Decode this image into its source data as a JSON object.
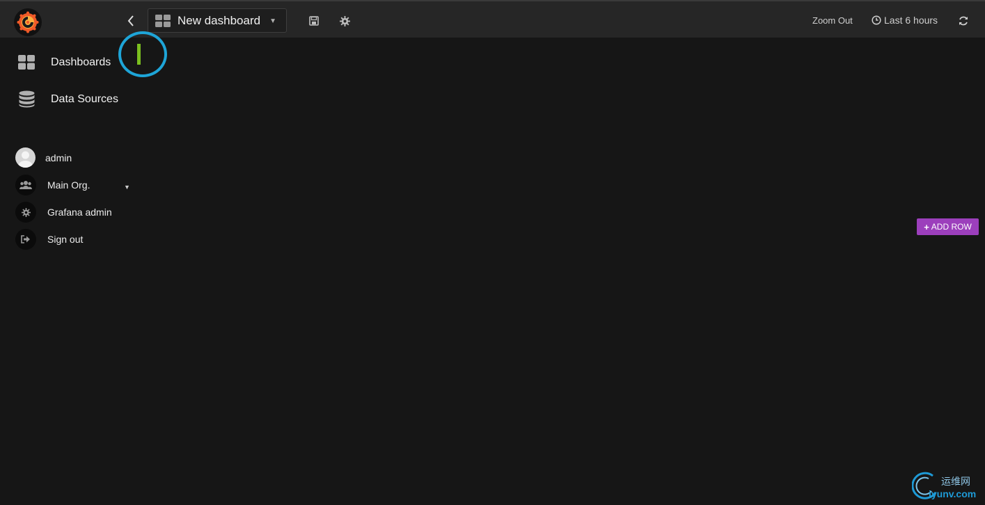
{
  "topbar": {
    "dashboard_title": "New dashboard",
    "zoom_out_label": "Zoom Out",
    "time_range_label": "Last 6 hours"
  },
  "sidemenu": {
    "items": [
      {
        "label": "Dashboards",
        "icon": "dashboards-grid-icon"
      },
      {
        "label": "Data Sources",
        "icon": "database-icon"
      }
    ],
    "user": {
      "name": "admin",
      "org": "Main Org.",
      "grafana_admin": "Grafana admin",
      "sign_out": "Sign out"
    }
  },
  "main": {
    "add_row_label": "ADD ROW"
  },
  "watermark": {
    "cn_text": "运维网",
    "en_text": "iyunv.com"
  },
  "colors": {
    "background": "#161616",
    "topbar": "#262626",
    "add_row": "#9c3fbc",
    "highlight_ring": "#1ea5d8",
    "highlight_bar": "#7bbf1f"
  }
}
